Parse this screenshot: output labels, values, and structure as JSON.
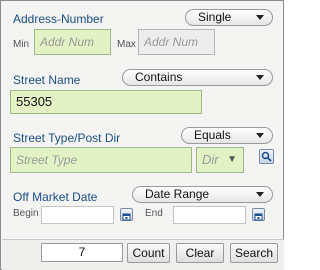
{
  "address": {
    "label": "Address-Number",
    "mode": "Single",
    "min_label": "Min",
    "min_placeholder": "Addr Num",
    "max_label": "Max",
    "max_placeholder": "Addr Num"
  },
  "street_name": {
    "label": "Street Name",
    "mode": "Contains",
    "value": "55305"
  },
  "street_type": {
    "label": "Street Type/Post Dir",
    "mode": "Equals",
    "type_placeholder": "Street Type",
    "dir_placeholder": "Dir"
  },
  "off_market": {
    "label": "Off Market Date",
    "mode": "Date Range",
    "begin_label": "Begin",
    "end_label": "End"
  },
  "footer": {
    "count_value": "7",
    "count_label": "Count",
    "clear_label": "Clear",
    "search_label": "Search"
  }
}
